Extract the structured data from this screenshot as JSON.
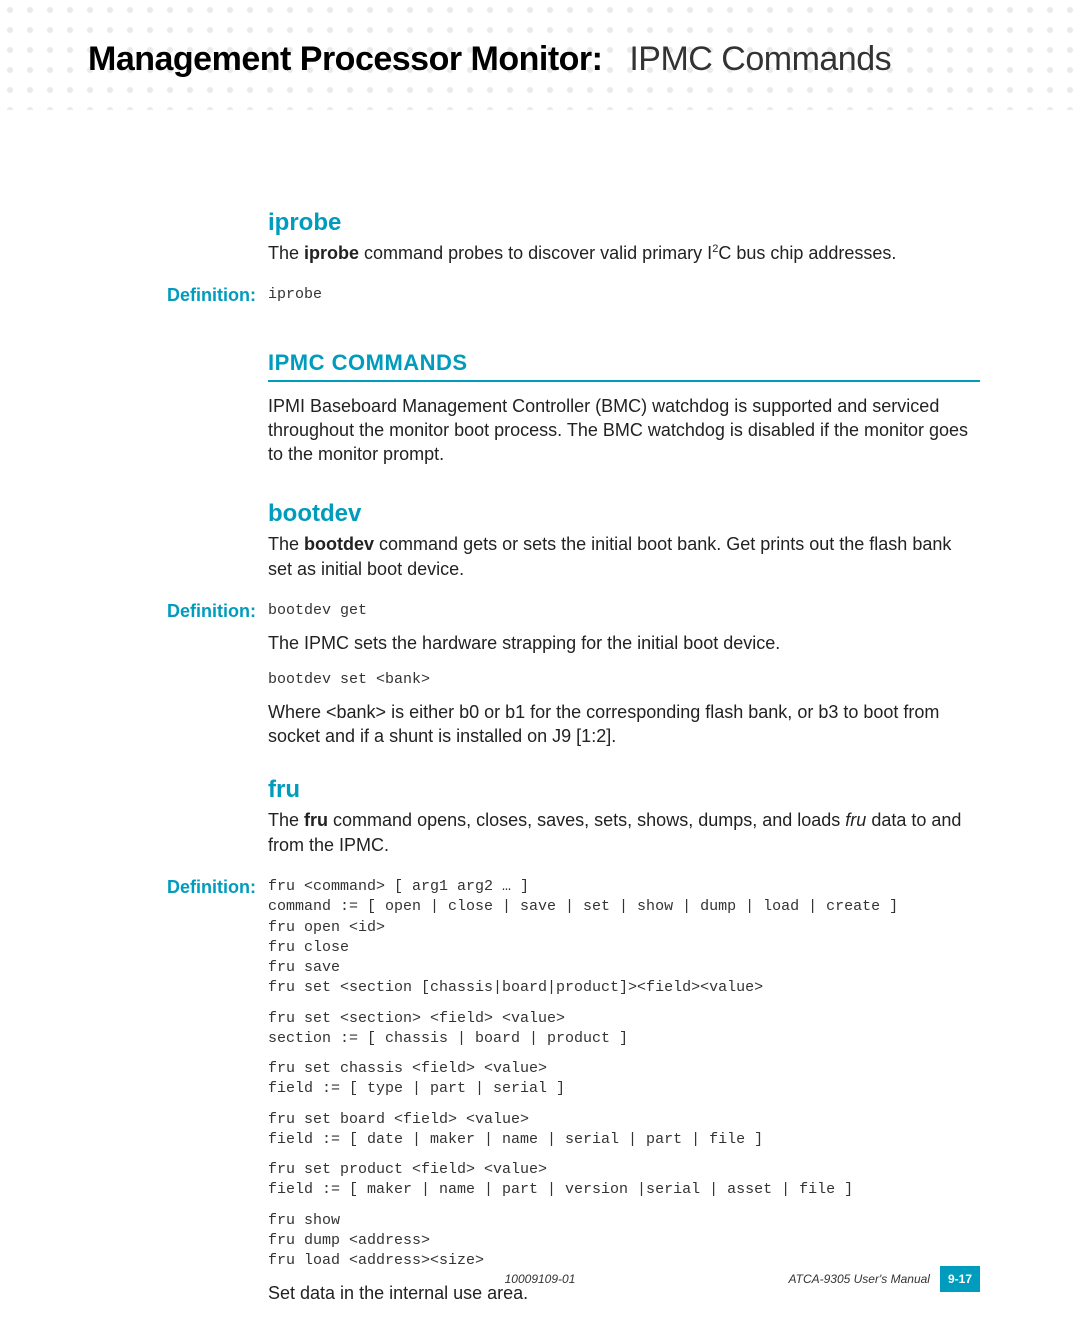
{
  "header": {
    "title_bold": "Management Processor Monitor:",
    "title_light": "IPMC Commands"
  },
  "iprobe": {
    "heading": "iprobe",
    "desc_prefix": "The ",
    "desc_cmd": "iprobe",
    "desc_mid": " command probes to discover valid primary I",
    "desc_sup": "2",
    "desc_suffix": "C bus chip addresses.",
    "def_label": "Definition:",
    "def_code": "iprobe"
  },
  "ipmc_section": {
    "heading": "IPMC COMMANDS",
    "intro": "IPMI Baseboard Management Controller (BMC) watchdog is supported and serviced throughout the monitor boot process. The BMC watchdog is disabled if the monitor goes to the monitor prompt."
  },
  "bootdev": {
    "heading": "bootdev",
    "desc_prefix": "The ",
    "desc_cmd": "bootdev",
    "desc_suffix": " command gets or sets the initial boot bank. Get prints out the flash bank set as initial boot device.",
    "def_label": "Definition:",
    "def_code1": "bootdev get",
    "mid_text": "The IPMC sets the hardware strapping for the initial boot device.",
    "def_code2": "bootdev set <bank>",
    "where_text": "Where <bank> is either b0 or b1 for the corresponding flash bank, or b3 to boot from socket and if a shunt is installed on J9 [1:2]."
  },
  "fru": {
    "heading": "fru",
    "desc_prefix": "The ",
    "desc_cmd": "fru",
    "desc_mid": " command opens, closes, saves, sets, shows, dumps, and loads ",
    "desc_italic": "fru",
    "desc_suffix": " data to and from the IPMC.",
    "def_label": "Definition:",
    "code1": "fru <command> [ arg1 arg2 … ]\ncommand := [ open | close | save | set | show | dump | load | create ]\nfru open <id>\nfru close\nfru save\nfru set <section [chassis|board|product]><field><value>",
    "code2": "fru set <section> <field> <value>\nsection := [ chassis | board | product ]",
    "code3": "fru set chassis <field> <value>\nfield := [ type | part | serial ]",
    "code4": "fru set board <field> <value>\nfield := [ date | maker | name | serial | part | file ]",
    "code5": "fru set product <field> <value>\nfield := [ maker | name | part | version |serial | asset | file ]",
    "code6": "fru show\nfru dump <address>\nfru load <address><size>",
    "trailing": "Set data in the internal use area."
  },
  "footer": {
    "docnum": "10009109-01",
    "manual": "ATCA-9305 User's Manual",
    "page": "9-17"
  }
}
